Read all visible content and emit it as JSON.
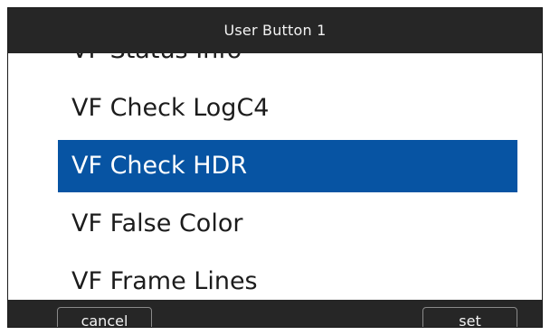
{
  "header": {
    "title": "User Button 1"
  },
  "menu": {
    "items": [
      {
        "label": "VF Status Info"
      },
      {
        "label": "VF Check LogC4"
      },
      {
        "label": "VF Check HDR"
      },
      {
        "label": "VF False Color"
      },
      {
        "label": "VF Frame Lines"
      }
    ],
    "selected_index": 2
  },
  "footer": {
    "cancel_label": "cancel",
    "set_label": "set"
  },
  "colors": {
    "bar_background": "#262626",
    "selection": "#0754a3",
    "list_background": "#ffffff",
    "list_text": "#1c1c1c"
  }
}
